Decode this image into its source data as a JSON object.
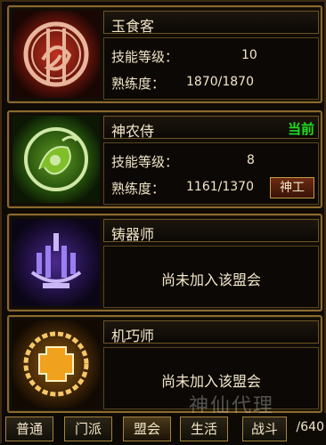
{
  "professions": [
    {
      "name": "玉食客",
      "skill_label": "技能等级：",
      "skill_value": "10",
      "proficiency_label": "熟练度：",
      "proficiency_value": "1870/1870"
    },
    {
      "name": "神农侍",
      "status": "当前",
      "skill_label": "技能等级：",
      "skill_value": "8",
      "proficiency_label": "熟练度：",
      "proficiency_value": "1161/1370",
      "action_label": "神工"
    },
    {
      "name": "铸器师",
      "not_joined_text": "尚未加入该盟会"
    },
    {
      "name": "机巧师",
      "not_joined_text": "尚未加入该盟会"
    }
  ],
  "tabs": [
    {
      "label": "普通"
    },
    {
      "label": "门派"
    },
    {
      "label": "盟会"
    },
    {
      "label": "生活"
    },
    {
      "label": "战斗"
    }
  ],
  "page_count_text": "/640",
  "watermark_text": "神仙代理",
  "colors": {
    "accent_red": "#a3251c",
    "accent_green": "#7fbf2a",
    "accent_purple": "#9b7ff0",
    "accent_orange": "#f0a11e",
    "status_green": "#1ee21e",
    "gold_border": "#8a6a2e"
  }
}
